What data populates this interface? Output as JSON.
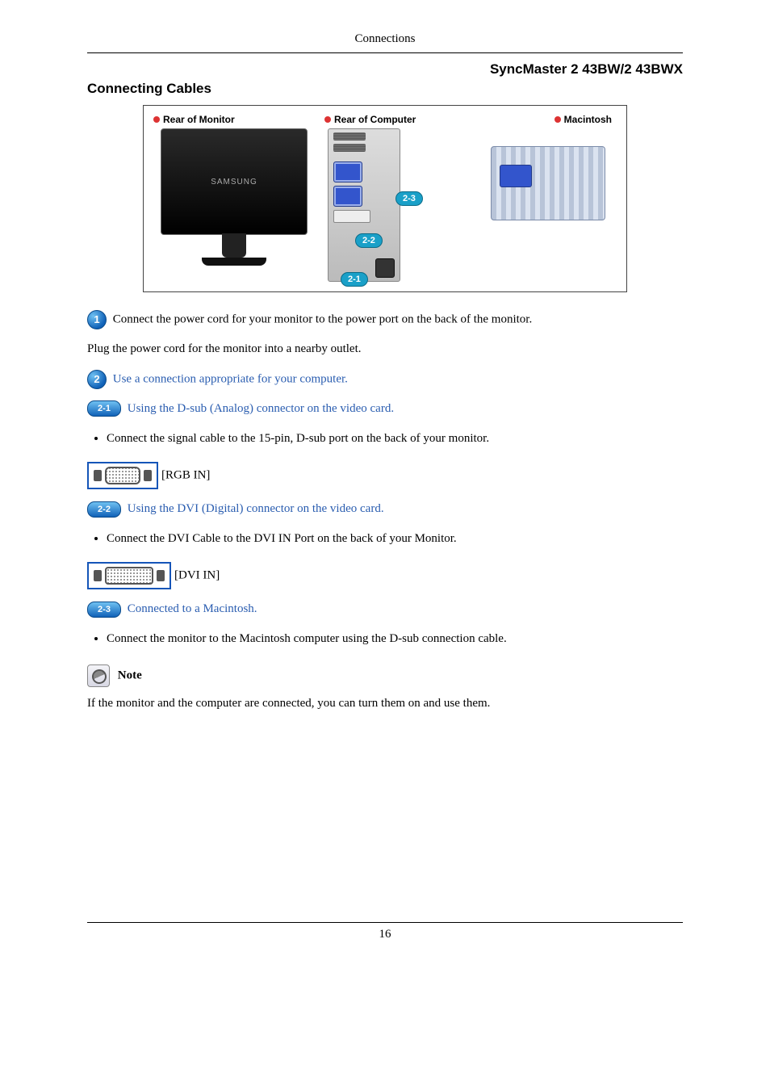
{
  "header": {
    "running": "Connections"
  },
  "model_line": "SyncMaster 2  43BW/2  43BWX",
  "section_title": "Connecting Cables",
  "diagram": {
    "monitor_label": "Rear of Monitor",
    "monitor_brand": "SAMSUNG",
    "computer_label": "Rear of Computer",
    "mac_label": "Macintosh",
    "callouts": {
      "a": "2-3",
      "b": "2-2",
      "c": "2-1"
    }
  },
  "steps": {
    "one_text": " Connect the power cord for your monitor to the power port on the back of the monitor.",
    "one_follow": "Plug the power cord for the monitor into a nearby outlet.",
    "two_text": " Use a connection appropriate for your computer.",
    "two_one_text": " Using the D-sub (Analog) connector on the video card.",
    "two_one_bullet": "Connect the signal cable to the 15-pin, D-sub port on the back of your monitor.",
    "rgb_label": "[RGB IN]",
    "two_two_text": " Using the DVI (Digital) connector on the video card.",
    "two_two_bullet": "Connect the DVI Cable to the DVI IN Port on the back of your Monitor.",
    "dvi_label": "[DVI IN]",
    "two_three_text": " Connected to a Macintosh.",
    "two_three_bullet": "Connect the monitor to the Macintosh computer using the D-sub connection cable."
  },
  "note": {
    "label": " Note",
    "text": "If the monitor and the computer are connected, you can turn them on and use them."
  },
  "page_number": "16",
  "icons": {
    "one": "1",
    "two": "2",
    "two_one": "2-1",
    "two_two": "2-2",
    "two_three": "2-3"
  }
}
